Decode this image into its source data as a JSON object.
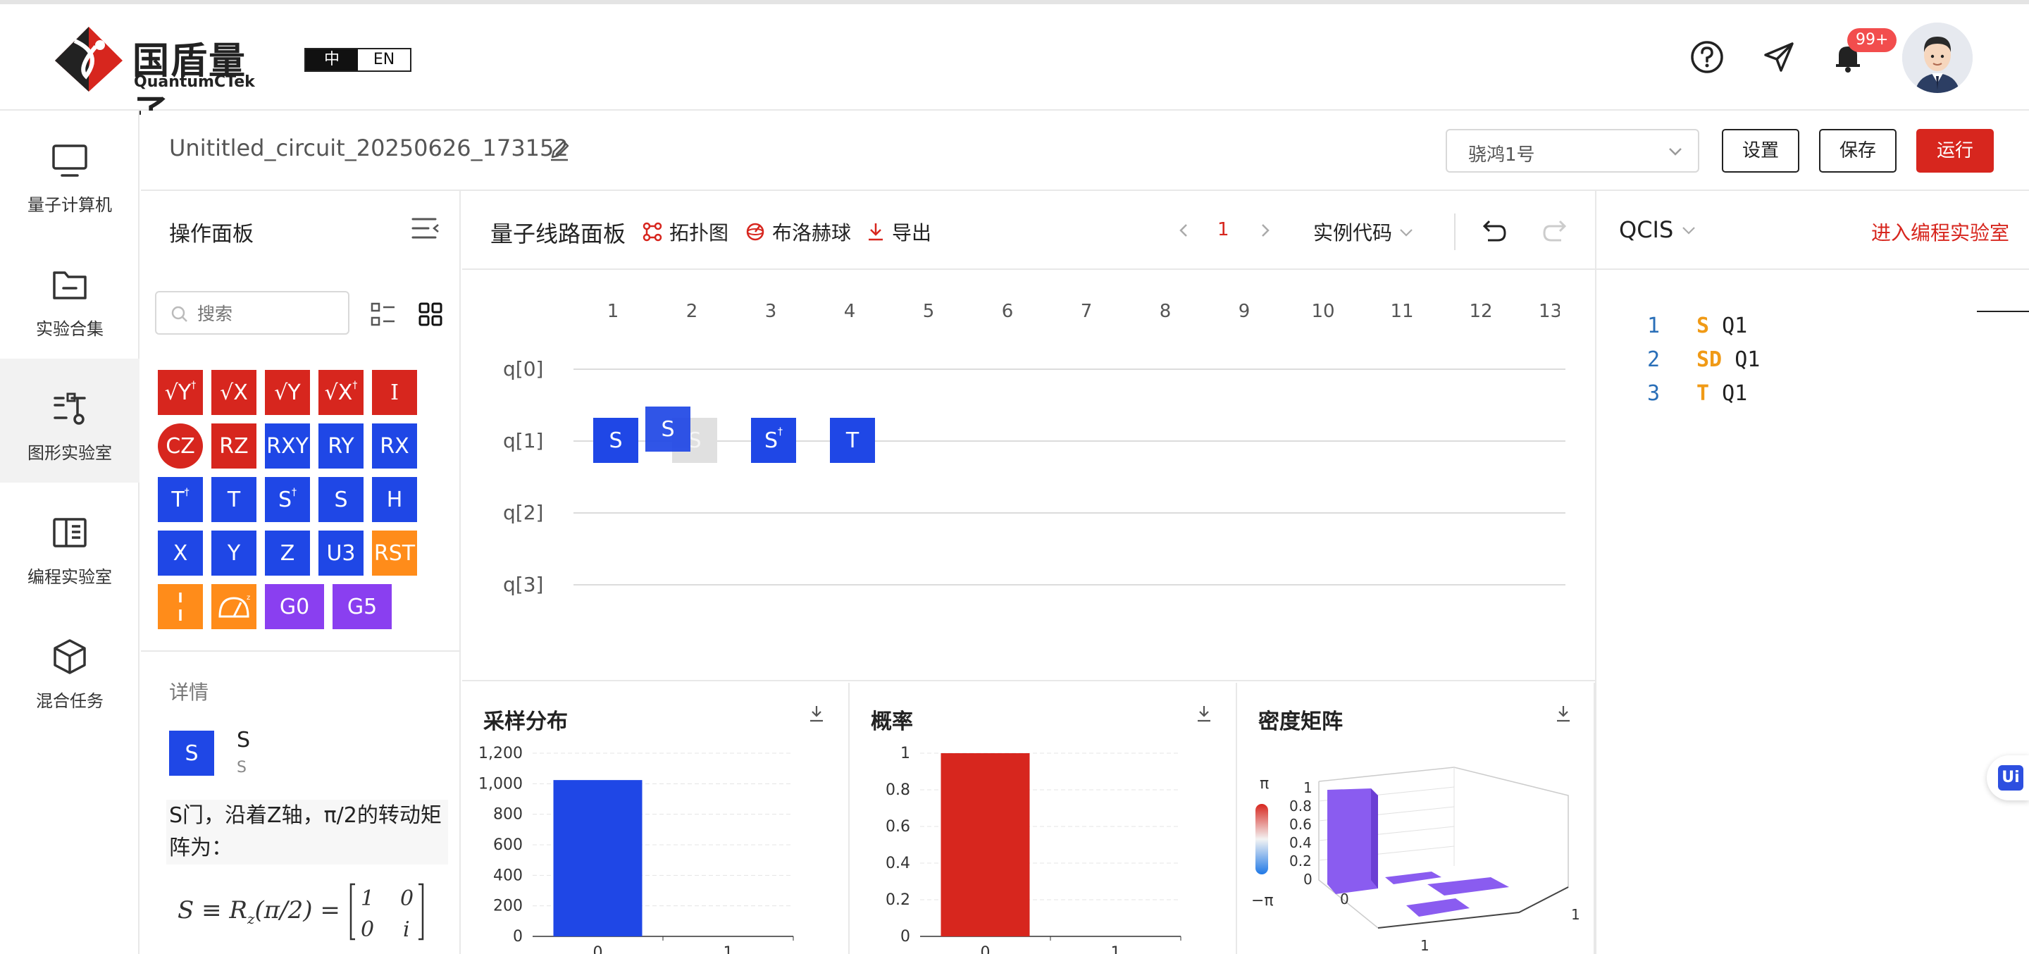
{
  "brand": {
    "name_cn": "国盾量子",
    "name_en": "QuantumCTek"
  },
  "lang": {
    "cn": "中",
    "en": "EN"
  },
  "header": {
    "notification_badge": "99+"
  },
  "nav": [
    {
      "label": "量子计算机",
      "icon": "monitor-icon"
    },
    {
      "label": "实验合集",
      "icon": "folder-icon"
    },
    {
      "label": "图形实验室",
      "icon": "graph-lab-icon"
    },
    {
      "label": "编程实验室",
      "icon": "book-icon"
    },
    {
      "label": "混合任务",
      "icon": "cube-icon"
    }
  ],
  "titlebar": {
    "circuit_name": "Unititled_circuit_20250626_173152",
    "device": "骁鸿1号",
    "settings": "设置",
    "save": "保存",
    "run": "运行"
  },
  "op_panel": {
    "title": "操作面板",
    "search_placeholder": "搜索",
    "gates_row1": [
      "√Y†",
      "√X",
      "√Y",
      "√X†",
      "I"
    ],
    "gates_row2": [
      "CZ",
      "RZ",
      "RXY",
      "RY",
      "RX"
    ],
    "gates_row3": [
      "T†",
      "T",
      "S†",
      "S",
      "H"
    ],
    "gates_row4": [
      "X",
      "Y",
      "Z",
      "U3",
      "RST"
    ],
    "gates_row5": [
      "G0",
      "G5"
    ],
    "details": {
      "heading": "详情",
      "gate": "S",
      "name": "S",
      "sub": "S",
      "desc": "S门，沿着Z轴，π/2的转动矩阵为：",
      "formula": "S ≡ R",
      "formula_sub": "z",
      "formula_rest": "(π/2) ="
    }
  },
  "circuit": {
    "title": "量子线路面板",
    "topology": "拓扑图",
    "bloch": "布洛赫球",
    "export": "导出",
    "page": "1",
    "example_code": "实例代码",
    "columns": [
      "1",
      "2",
      "3",
      "4",
      "5",
      "6",
      "7",
      "8",
      "9",
      "10",
      "11",
      "12",
      "13"
    ],
    "qubits": [
      "q[0]",
      "q[1]",
      "q[2]",
      "q[3]"
    ],
    "gates": [
      {
        "label": "S",
        "col": 1
      },
      {
        "label": "S",
        "col": 2
      },
      {
        "label": "S†",
        "col": 3
      },
      {
        "label": "T",
        "col": 4
      }
    ],
    "ghost_label": "S"
  },
  "charts": {
    "sampling": {
      "title": "采样分布",
      "chart_data": {
        "type": "bar",
        "categories": [
          "0",
          "1"
        ],
        "values": [
          1024,
          0
        ],
        "ylim": [
          0,
          1200
        ],
        "yticks": [
          "0",
          "200",
          "400",
          "600",
          "800",
          "1,000",
          "1,200"
        ],
        "color": "#1f47e6"
      }
    },
    "probability": {
      "title": "概率",
      "chart_data": {
        "type": "bar",
        "categories": [
          "0",
          "1"
        ],
        "values": [
          1,
          0
        ],
        "ylim": [
          0,
          1
        ],
        "yticks": [
          "0",
          "0.2",
          "0.4",
          "0.6",
          "0.8",
          "1"
        ],
        "color": "#d7261e"
      }
    },
    "density": {
      "title": "密度矩阵",
      "pi_top": "π",
      "pi_bottom": "−π",
      "zticks": [
        "0",
        "0.2",
        "0.4",
        "0.6",
        "0.8",
        "1"
      ],
      "axis_labels": [
        "0",
        "1",
        "1"
      ],
      "bar_color": "#8a5cf0"
    }
  },
  "qcis": {
    "title": "QCIS",
    "link": "进入编程实验室",
    "lines": [
      {
        "n": "1",
        "op": "S",
        "arg": "Q1"
      },
      {
        "n": "2",
        "op": "SD",
        "arg": "Q1"
      },
      {
        "n": "3",
        "op": "T",
        "arg": "Q1"
      }
    ]
  },
  "float_button": "Ui"
}
